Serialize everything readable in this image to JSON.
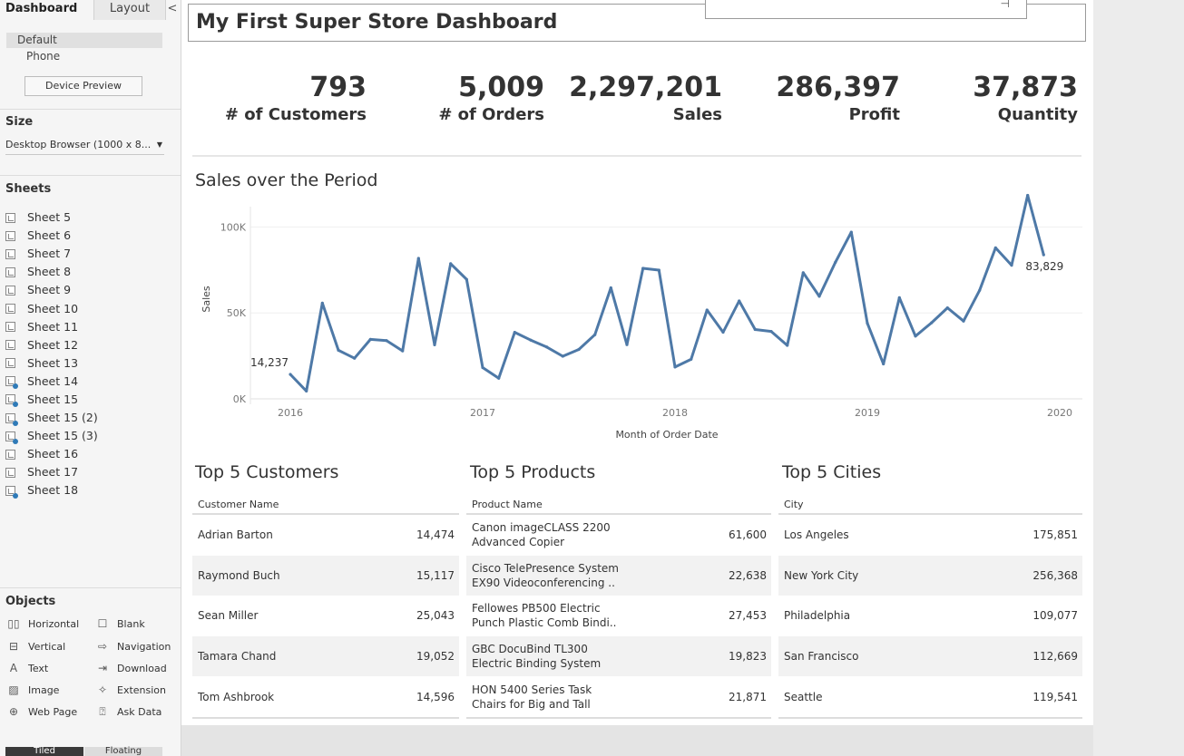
{
  "left_panel": {
    "tabs": {
      "dashboard": "Dashboard",
      "layout": "Layout",
      "collapse": "<"
    },
    "devices": {
      "default": "Default",
      "phone": "Phone",
      "preview_button": "Device Preview"
    },
    "size": {
      "title": "Size",
      "value": "Desktop Browser (1000 x 8..."
    },
    "sheets": {
      "title": "Sheets",
      "items": [
        {
          "label": "Sheet 5",
          "marked": false
        },
        {
          "label": "Sheet 6",
          "marked": false
        },
        {
          "label": "Sheet 7",
          "marked": false
        },
        {
          "label": "Sheet 8",
          "marked": false
        },
        {
          "label": "Sheet 9",
          "marked": false
        },
        {
          "label": "Sheet 10",
          "marked": false
        },
        {
          "label": "Sheet 11",
          "marked": false
        },
        {
          "label": "Sheet 12",
          "marked": false
        },
        {
          "label": "Sheet 13",
          "marked": false
        },
        {
          "label": "Sheet 14",
          "marked": true
        },
        {
          "label": "Sheet 15",
          "marked": true
        },
        {
          "label": "Sheet 15 (2)",
          "marked": true
        },
        {
          "label": "Sheet 15 (3)",
          "marked": true
        },
        {
          "label": "Sheet 16",
          "marked": false
        },
        {
          "label": "Sheet 17",
          "marked": false
        },
        {
          "label": "Sheet 18",
          "marked": true
        }
      ]
    },
    "objects": {
      "title": "Objects",
      "items": [
        {
          "label": "Horizontal",
          "icon": "horizontal-icon",
          "glyph": "▯▯"
        },
        {
          "label": "Blank",
          "icon": "blank-icon",
          "glyph": "☐"
        },
        {
          "label": "Vertical",
          "icon": "vertical-icon",
          "glyph": "⊟"
        },
        {
          "label": "Navigation",
          "icon": "navigation-icon",
          "glyph": "⇨"
        },
        {
          "label": "Text",
          "icon": "text-icon",
          "glyph": "A"
        },
        {
          "label": "Download",
          "icon": "download-icon",
          "glyph": "⇥"
        },
        {
          "label": "Image",
          "icon": "image-icon",
          "glyph": "▨"
        },
        {
          "label": "Extension",
          "icon": "extension-icon",
          "glyph": "✧"
        },
        {
          "label": "Web Page",
          "icon": "globe-icon",
          "glyph": "⊕"
        },
        {
          "label": "Ask Data",
          "icon": "ask-data-icon",
          "glyph": "⍰"
        }
      ]
    },
    "bottom_tabs": {
      "tiled": "Tiled",
      "floating": "Floating"
    }
  },
  "dashboard": {
    "title": "My First Super Store Dashboard",
    "pin_icon": "pin-icon",
    "kpis": [
      {
        "value": "793",
        "label": "# of Customers"
      },
      {
        "value": "5,009",
        "label": "# of Orders"
      },
      {
        "value": "2,297,201",
        "label": "Sales"
      },
      {
        "value": "286,397",
        "label": "Profit"
      },
      {
        "value": "37,873",
        "label": "Quantity"
      }
    ],
    "chart_title": "Sales over the Period",
    "chart_data": {
      "type": "line",
      "title": "Sales over the Period",
      "xlabel": "Month of Order Date",
      "ylabel": "Sales",
      "x_ticks": [
        "2016",
        "2017",
        "2018",
        "2019",
        "2020"
      ],
      "y_ticks": [
        "0K",
        "50K",
        "100K"
      ],
      "ylim": [
        0,
        115000
      ],
      "xlim": [
        2016,
        2020
      ],
      "line_color": "#4e79a7",
      "grid": true,
      "start_label": "14,237",
      "end_label": "83,829",
      "x": [
        "2016-01",
        "2016-02",
        "2016-03",
        "2016-04",
        "2016-05",
        "2016-06",
        "2016-07",
        "2016-08",
        "2016-09",
        "2016-10",
        "2016-11",
        "2016-12",
        "2017-01",
        "2017-02",
        "2017-03",
        "2017-04",
        "2017-05",
        "2017-06",
        "2017-07",
        "2017-08",
        "2017-09",
        "2017-10",
        "2017-11",
        "2017-12",
        "2018-01",
        "2018-02",
        "2018-03",
        "2018-04",
        "2018-05",
        "2018-06",
        "2018-07",
        "2018-08",
        "2018-09",
        "2018-10",
        "2018-11",
        "2018-12",
        "2019-01",
        "2019-02",
        "2019-03",
        "2019-04",
        "2019-05",
        "2019-06",
        "2019-07",
        "2019-08",
        "2019-09",
        "2019-10",
        "2019-11",
        "2019-12"
      ],
      "values": [
        14237,
        4520,
        55691,
        28295,
        23648,
        34595,
        33946,
        27909,
        81777,
        31453,
        78629,
        69546,
        18174,
        11951,
        38726,
        34195,
        30132,
        24797,
        28765,
        37350,
        64596,
        31533,
        75973,
        74919,
        18542,
        22979,
        51715,
        38750,
        56988,
        40344,
        39262,
        31115,
        73410,
        59688,
        79412,
        96999,
        43971,
        20301,
        58872,
        36521,
        44261,
        52981,
        45264,
        63121,
        87867,
        77777,
        118448,
        83829
      ]
    },
    "tables": [
      {
        "title": "Top 5 Customers",
        "header": "Customer Name",
        "rows": [
          {
            "name": "Adrian Barton",
            "value": "14,474"
          },
          {
            "name": "Raymond Buch",
            "value": "15,117"
          },
          {
            "name": "Sean Miller",
            "value": "25,043"
          },
          {
            "name": "Tamara Chand",
            "value": "19,052"
          },
          {
            "name": "Tom Ashbrook",
            "value": "14,596"
          }
        ]
      },
      {
        "title": "Top 5 Products",
        "header": "Product Name",
        "rows": [
          {
            "name": "Canon imageCLASS 2200\nAdvanced Copier",
            "value": "61,600"
          },
          {
            "name": "Cisco TelePresence System\nEX90 Videoconferencing ..",
            "value": "22,638"
          },
          {
            "name": "Fellowes PB500 Electric\nPunch Plastic Comb Bindi..",
            "value": "27,453"
          },
          {
            "name": "GBC DocuBind TL300\nElectric Binding System",
            "value": "19,823"
          },
          {
            "name": "HON 5400 Series Task\nChairs for Big and Tall",
            "value": "21,871"
          }
        ]
      },
      {
        "title": "Top 5 Cities",
        "header": "City",
        "rows": [
          {
            "name": "Los Angeles",
            "value": "175,851"
          },
          {
            "name": "New York City",
            "value": "256,368"
          },
          {
            "name": "Philadelphia",
            "value": "109,077"
          },
          {
            "name": "San Francisco",
            "value": "112,669"
          },
          {
            "name": "Seattle",
            "value": "119,541"
          }
        ]
      }
    ]
  }
}
